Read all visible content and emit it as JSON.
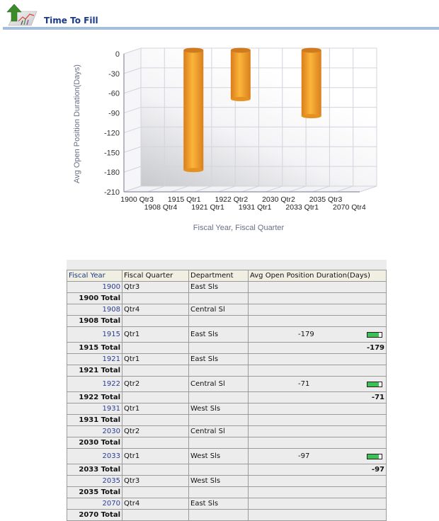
{
  "header": {
    "title": "Time To Fill",
    "icon": "chart-report-icon"
  },
  "chart_data": {
    "type": "bar",
    "style": "3d-cylinder",
    "title": "",
    "xlabel": "Fiscal Year, Fiscal Quarter",
    "ylabel": "Avg Open Position Duration(Days)",
    "ylim": [
      -210,
      0
    ],
    "yticks": [
      0,
      -30,
      -60,
      -90,
      -120,
      -150,
      -180,
      -210
    ],
    "grid": true,
    "categories": [
      "1900 Qtr3",
      "1908 Qtr4",
      "1915 Qtr1",
      "1921 Qtr1",
      "1922 Qtr2",
      "1931 Qtr1",
      "2030 Qtr2",
      "2033 Qtr1",
      "2035 Qtr3",
      "2070 Qtr4"
    ],
    "values": [
      null,
      null,
      -179,
      null,
      -71,
      null,
      null,
      -97,
      null,
      null
    ],
    "bar_color": "#f5a42a"
  },
  "table": {
    "headers": [
      "Fiscal Year",
      "Fiscal Quarter",
      "Department",
      "Avg Open Position Duration(Days)"
    ],
    "rows": [
      {
        "type": "data",
        "year": "1900",
        "quarter": "Qtr3",
        "dept": "East Sls",
        "value": ""
      },
      {
        "type": "total",
        "label": "1900 Total",
        "value": ""
      },
      {
        "type": "data",
        "year": "1908",
        "quarter": "Qtr4",
        "dept": "Central Sl",
        "value": ""
      },
      {
        "type": "total",
        "label": "1908 Total",
        "value": ""
      },
      {
        "type": "data",
        "year": "1915",
        "quarter": "Qtr1",
        "dept": "East Sls",
        "value": "-179",
        "meter": 0.8
      },
      {
        "type": "total",
        "label": "1915 Total",
        "value": "-179"
      },
      {
        "type": "data",
        "year": "1921",
        "quarter": "Qtr1",
        "dept": "East Sls",
        "value": ""
      },
      {
        "type": "total",
        "label": "1921 Total",
        "value": ""
      },
      {
        "type": "data",
        "year": "1922",
        "quarter": "Qtr2",
        "dept": "Central Sl",
        "value": "-71",
        "meter": 0.8
      },
      {
        "type": "total",
        "label": "1922 Total",
        "value": "-71"
      },
      {
        "type": "data",
        "year": "1931",
        "quarter": "Qtr1",
        "dept": "West Sls",
        "value": ""
      },
      {
        "type": "total",
        "label": "1931 Total",
        "value": ""
      },
      {
        "type": "data",
        "year": "2030",
        "quarter": "Qtr2",
        "dept": "Central Sl",
        "value": ""
      },
      {
        "type": "total",
        "label": "2030 Total",
        "value": ""
      },
      {
        "type": "data",
        "year": "2033",
        "quarter": "Qtr1",
        "dept": "West Sls",
        "value": "-97",
        "meter": 0.8
      },
      {
        "type": "total",
        "label": "2033 Total",
        "value": "-97"
      },
      {
        "type": "data",
        "year": "2035",
        "quarter": "Qtr3",
        "dept": "West Sls",
        "value": ""
      },
      {
        "type": "total",
        "label": "2035 Total",
        "value": ""
      },
      {
        "type": "data",
        "year": "2070",
        "quarter": "Qtr4",
        "dept": "East Sls",
        "value": ""
      },
      {
        "type": "total",
        "label": "2070 Total",
        "value": ""
      }
    ]
  }
}
